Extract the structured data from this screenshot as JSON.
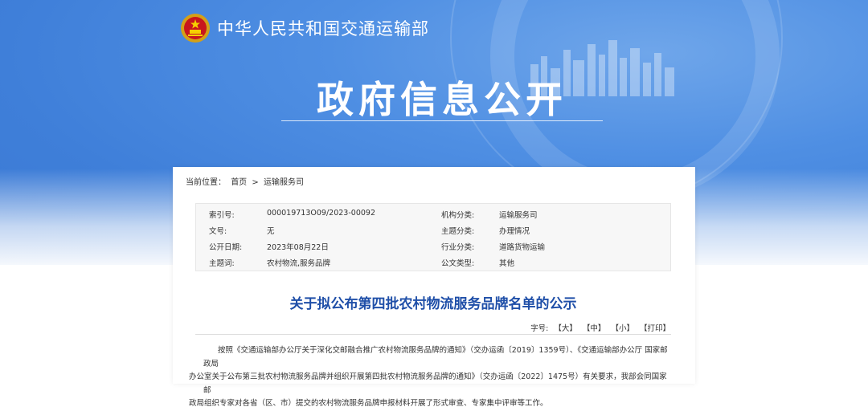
{
  "header": {
    "ministry_name": "中华人民共和国交通运输部",
    "section_title": "政府信息公开",
    "emblem_icon": "national-emblem-icon"
  },
  "breadcrumb": {
    "prefix": "当前位置：",
    "items": [
      "首页",
      ">",
      "运输服务司"
    ]
  },
  "meta": {
    "rows": [
      {
        "k1": "索引号:",
        "v1": "000019713O09/2023-00092",
        "k2": "机构分类:",
        "v2": "运输服务司"
      },
      {
        "k1": "文号:",
        "v1": "无",
        "k2": "主题分类:",
        "v2": "办理情况"
      },
      {
        "k1": "公开日期:",
        "v1": "2023年08月22日",
        "k2": "行业分类:",
        "v2": "道路货物运输"
      },
      {
        "k1": "主题词:",
        "v1": "农村物流,服务品牌",
        "k2": "公文类型:",
        "v2": "其他"
      }
    ]
  },
  "document": {
    "title": "关于拟公布第四批农村物流服务品牌名单的公示",
    "font_label": "字号:",
    "font_options": [
      "【大】",
      "【中】",
      "【小】"
    ],
    "print_label": "【打印】",
    "paragraph_lines": [
      "按照《交通运输部办公厅关于深化交邮融合推广农村物流服务品牌的通知》（交办运函〔2019〕1359号）、《交通运输部办公厅 国家邮政局",
      "办公室关于公布第三批农村物流服务品牌并组织开展第四批农村物流服务品牌的通知》（交办运函〔2022〕1475号）有关要求，我部会同国家邮",
      "政局组织专家对各省（区、市）提交的农村物流服务品牌申报材料开展了形式审查、专家集中评审等工作。"
    ]
  },
  "colors": {
    "hero_blue": "#3f7fd9",
    "title_blue": "#1f4fa8"
  }
}
